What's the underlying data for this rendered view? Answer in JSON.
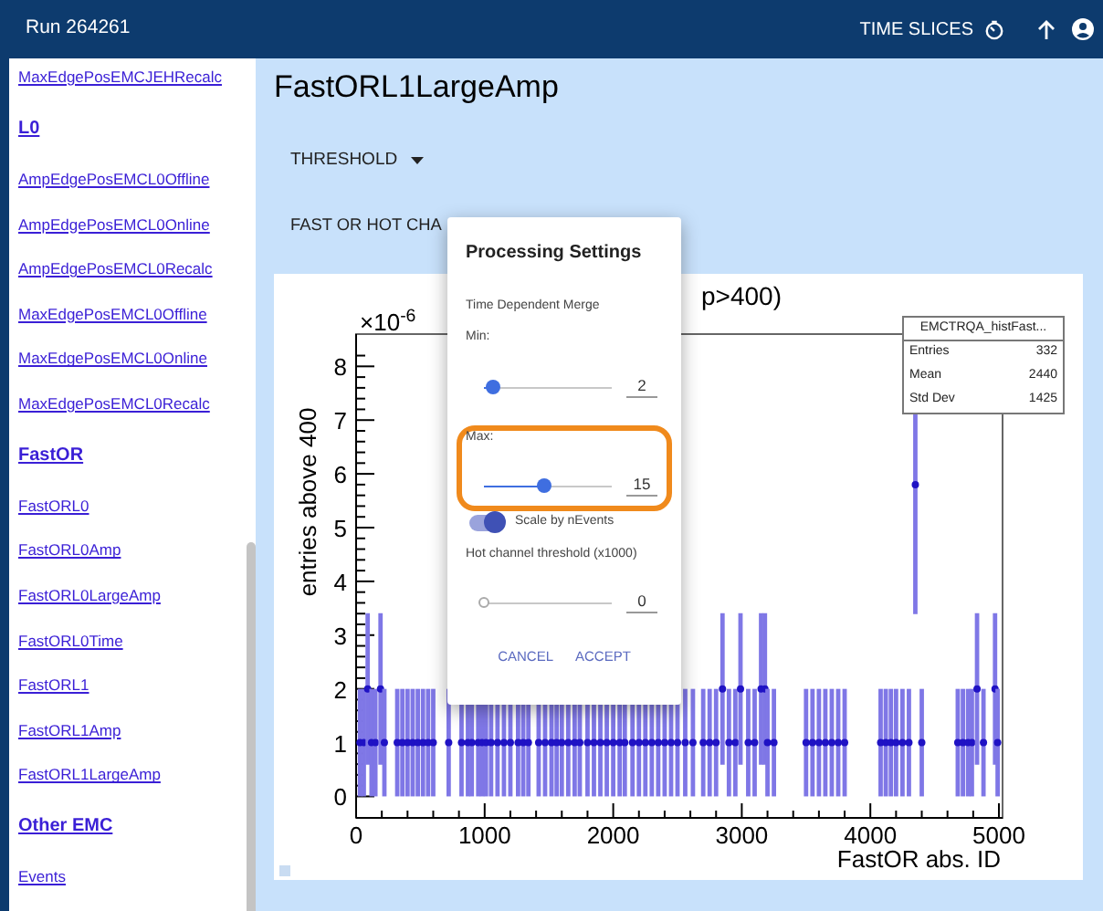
{
  "header": {
    "title": "Run 264261",
    "time_slices_button": "TIME SLICES"
  },
  "sidebar": {
    "sections": [
      {
        "items": [
          "MaxEdgePosEMCJEHRecalc"
        ]
      },
      {
        "title": "L0",
        "items": [
          "AmpEdgePosEMCL0Offline",
          "AmpEdgePosEMCL0Online",
          "AmpEdgePosEMCL0Recalc",
          "MaxEdgePosEMCL0Offline",
          "MaxEdgePosEMCL0Online",
          "MaxEdgePosEMCL0Recalc"
        ]
      },
      {
        "title": "FastOR",
        "items": [
          "FastORL0",
          "FastORL0Amp",
          "FastORL0LargeAmp",
          "FastORL0Time",
          "FastORL1",
          "FastORL1Amp",
          "FastORL1LargeAmp"
        ]
      },
      {
        "title": "Other EMC",
        "items": [
          "Events"
        ]
      }
    ]
  },
  "page": {
    "title": "FastORL1LargeAmp",
    "threshold_menu": "THRESHOLD",
    "section_label": "FAST OR HOT CHA"
  },
  "plot": {
    "exponent_label": "×10$^{-6}$",
    "stats": {
      "title": "EMCTRQA_histFast...",
      "rows": [
        {
          "label": "Entries",
          "value": "332"
        },
        {
          "label": "Mean",
          "value": "2440"
        },
        {
          "label": "Std Dev",
          "value": "1425"
        }
      ]
    },
    "chart_data": {
      "type": "scatter",
      "title": "p>400)",
      "xlabel": "FastOR abs. ID",
      "ylabel": "entries above 400",
      "xlim": [
        0,
        5000
      ],
      "ylim": [
        -0.4,
        8.6
      ],
      "xticks": [
        0,
        1000,
        2000,
        3000,
        4000,
        5000
      ],
      "yticks": [
        0,
        1,
        2,
        3,
        4,
        5,
        6,
        7,
        8
      ],
      "x": [
        30,
        60,
        90,
        120,
        150,
        190,
        220,
        320,
        360,
        400,
        440,
        480,
        520,
        560,
        600,
        720,
        820,
        870,
        900,
        950,
        980,
        1010,
        1050,
        1100,
        1150,
        1200,
        1260,
        1300,
        1340,
        1420,
        1470,
        1520,
        1560,
        1600,
        1650,
        1700,
        1740,
        1800,
        1850,
        1900,
        1950,
        2000,
        2050,
        2090,
        2150,
        2200,
        2250,
        2300,
        2350,
        2400,
        2450,
        2500,
        2560,
        2620,
        2700,
        2750,
        2800,
        2850,
        2900,
        2950,
        2990,
        3050,
        3100,
        3150,
        3180,
        3200,
        3250,
        3500,
        3550,
        3600,
        3650,
        3700,
        3750,
        3800,
        4080,
        4120,
        4160,
        4200,
        4250,
        4300,
        4350,
        4400,
        4680,
        4720,
        4760,
        4790,
        4830,
        4880,
        4970,
        4990
      ],
      "errors": [
        1,
        1,
        1.41,
        1,
        1,
        1.41,
        1,
        1,
        1,
        1,
        1,
        1,
        1,
        1,
        1,
        1,
        1,
        1,
        1,
        1,
        1,
        1,
        1,
        1,
        1,
        1,
        1,
        1,
        1,
        1,
        1,
        1,
        1,
        1,
        1,
        1,
        1,
        1,
        1,
        1,
        1,
        1,
        1,
        1,
        1,
        1,
        1,
        1,
        1,
        1,
        1,
        1,
        1,
        1,
        1,
        1,
        1,
        1.41,
        1,
        1,
        1.41,
        1,
        1,
        1.41,
        1.41,
        1,
        1,
        1,
        1,
        1,
        1,
        1,
        1,
        1,
        1,
        1,
        1,
        1,
        1,
        1,
        2.41,
        1,
        1,
        1,
        1,
        1,
        1.41,
        1,
        1.41,
        1
      ],
      "values": [
        1,
        1,
        2,
        1,
        1,
        2,
        1,
        1,
        1,
        1,
        1,
        1,
        1,
        1,
        1,
        1,
        1,
        1,
        1,
        1,
        1,
        1,
        1,
        1,
        1,
        1,
        1,
        1,
        1,
        1,
        1,
        1,
        1,
        1,
        1,
        1,
        1,
        1,
        1,
        1,
        1,
        1,
        1,
        1,
        1,
        1,
        1,
        1,
        1,
        1,
        1,
        1,
        1,
        1,
        1,
        1,
        1,
        2,
        1,
        1,
        2,
        1,
        1,
        2,
        2,
        1,
        1,
        1,
        1,
        1,
        1,
        1,
        1,
        1,
        1,
        1,
        1,
        1,
        1,
        1,
        5.8,
        1,
        1,
        1,
        1,
        1,
        2,
        1,
        2,
        1
      ]
    }
  },
  "dialog": {
    "title": "Processing Settings",
    "group_label": "Time Dependent Merge",
    "sliders": [
      {
        "label": "Min:",
        "level": 0.07,
        "value": "2",
        "highlighted": false
      },
      {
        "label": "Max:",
        "level": 0.47,
        "value": "15",
        "highlighted": true
      }
    ],
    "toggle": {
      "label": "Scale by nEvents",
      "on": true
    },
    "hot_channel": {
      "label": "Hot channel threshold (x1000)",
      "level": 0,
      "value": "0"
    },
    "buttons": [
      "CANCEL",
      "ACCEPT"
    ]
  }
}
